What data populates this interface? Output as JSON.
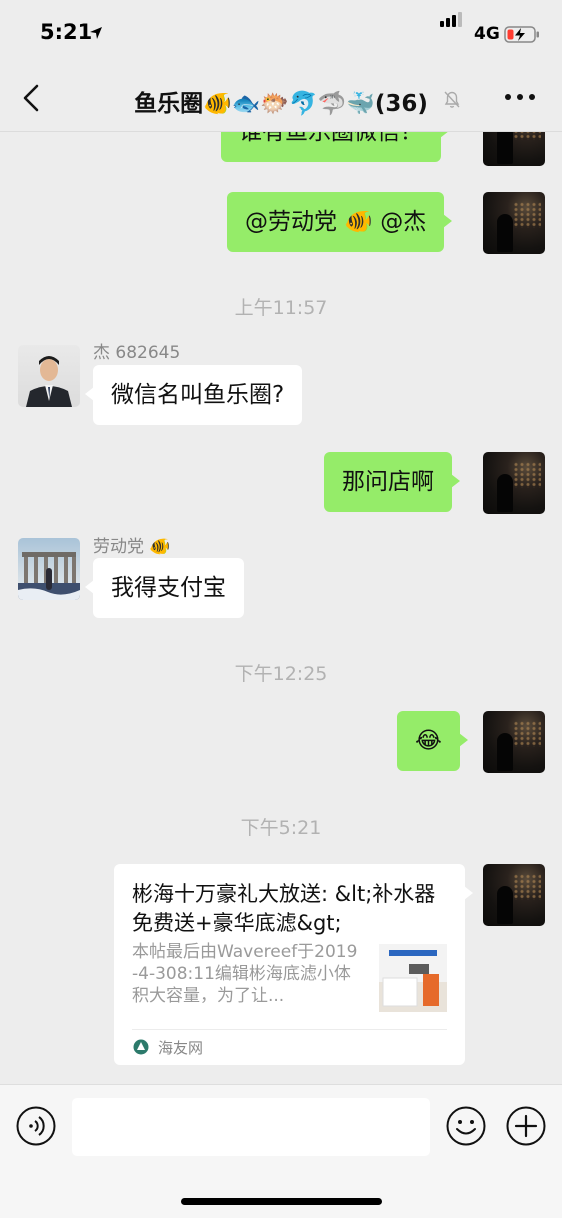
{
  "status_bar": {
    "time": "5:21",
    "network": "4G",
    "battery_color": "#ff3b30"
  },
  "header": {
    "back_icon": "chevron-left-icon",
    "title": "鱼乐圈🐠🐟🐡🐬🦈🐳(36)",
    "muted_icon": "bell-slash-icon",
    "more_icon": "more-dots-icon"
  },
  "chat": {
    "messages": [
      {
        "type": "text",
        "direction": "out",
        "text": "谁有鱼乐圈微信？"
      },
      {
        "type": "text",
        "direction": "out",
        "text": "@劳动党 🐠 @杰"
      },
      {
        "type": "time",
        "text": "上午11:57"
      },
      {
        "type": "text",
        "direction": "in",
        "sender": "杰  682645",
        "text": "微信名叫鱼乐圈?"
      },
      {
        "type": "text",
        "direction": "out",
        "text": "那问店啊"
      },
      {
        "type": "text",
        "direction": "in",
        "sender": "劳动党 🐠",
        "text": "我得支付宝"
      },
      {
        "type": "time",
        "text": "下午12:25"
      },
      {
        "type": "text",
        "direction": "out",
        "text": "😂"
      },
      {
        "type": "time",
        "text": "下午5:21"
      },
      {
        "type": "link_card",
        "direction": "out",
        "title": "彬海十万豪礼大放送: &lt;补水器免费送+豪华底滤&gt;",
        "description": "本帖最后由Wavereef于2019-4-308:11编辑彬海底滤小体积大容量，为了让...",
        "source": "海友网"
      }
    ]
  },
  "input_bar": {
    "voice_icon": "voice-icon",
    "emoji_icon": "emoji-icon",
    "plus_icon": "plus-icon",
    "value": ""
  },
  "colors": {
    "outgoing_bubble": "#95ec69",
    "incoming_bubble": "#ffffff",
    "background": "#ededed"
  }
}
